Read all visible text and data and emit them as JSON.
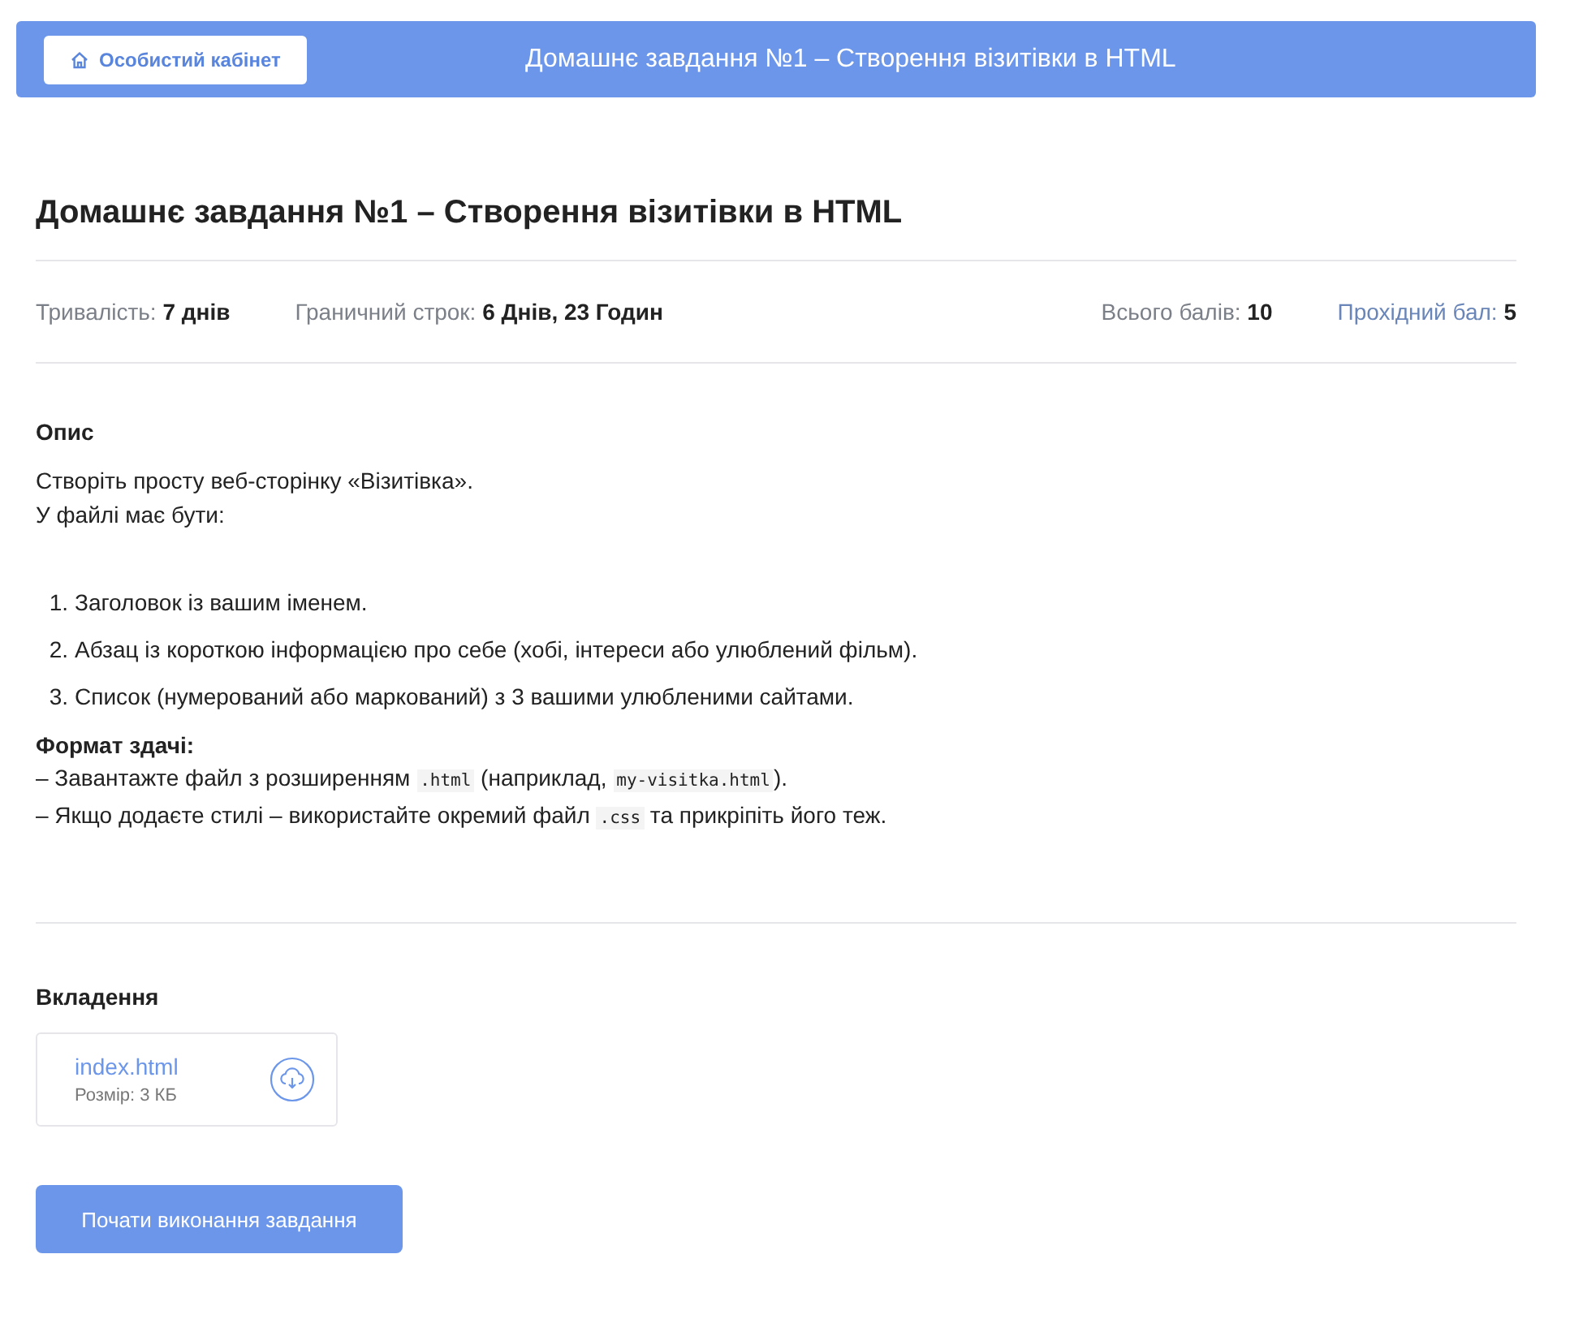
{
  "header": {
    "back_button": "Особистий кабінет",
    "title": "Домашнє завдання №1 – Створення візитівки в HTML"
  },
  "title": "Домашнє завдання №1 – Створення візитівки в HTML",
  "meta": [
    {
      "label": "Тривалість:",
      "value": "7 днів",
      "kind": "plain"
    },
    {
      "label": "Граничний строк:",
      "value": "6 Днів, 23 Годин",
      "kind": "plain"
    },
    {
      "label": "Всього балів:",
      "value": "10",
      "kind": "plain"
    },
    {
      "label": "Прохідний бал:",
      "value": "5",
      "kind": "accent"
    }
  ],
  "description": {
    "heading": "Опис",
    "intro": [
      "Створіть просту веб-сторінку «Візитівка».",
      "У файлі має бути:"
    ],
    "steps": [
      {
        "marker": "1.",
        "text": "Заголовок із вашим іменем."
      },
      {
        "marker": "2.",
        "text": "Абзац із короткою інформацією про себе (хобі, інтереси або улюблений фільм)."
      },
      {
        "marker": "3.",
        "text": "Список (нумерований або маркований) з 3 вашими улюбленими сайтами."
      }
    ],
    "format_heading": "Формат здачі:",
    "format_lines": [
      [
        {
          "kind": "text",
          "text": "– Завантажте файл з розширенням "
        },
        {
          "kind": "code",
          "text": ".html"
        },
        {
          "kind": "text",
          "text": " (наприклад, "
        },
        {
          "kind": "code",
          "text": "my-visitka.html"
        },
        {
          "kind": "text",
          "text": ")."
        }
      ],
      [
        {
          "kind": "text",
          "text": "– Якщо додаєте стилі – використайте окремий файл "
        },
        {
          "kind": "code",
          "text": ".css"
        },
        {
          "kind": "text",
          "text": " та прикріпіть його теж."
        }
      ]
    ]
  },
  "attachments": {
    "heading": "Вкладення",
    "files": [
      {
        "name": "index.html",
        "size": "Розмір: 3 КБ"
      }
    ]
  },
  "start_button": "Почати виконання завдання"
}
